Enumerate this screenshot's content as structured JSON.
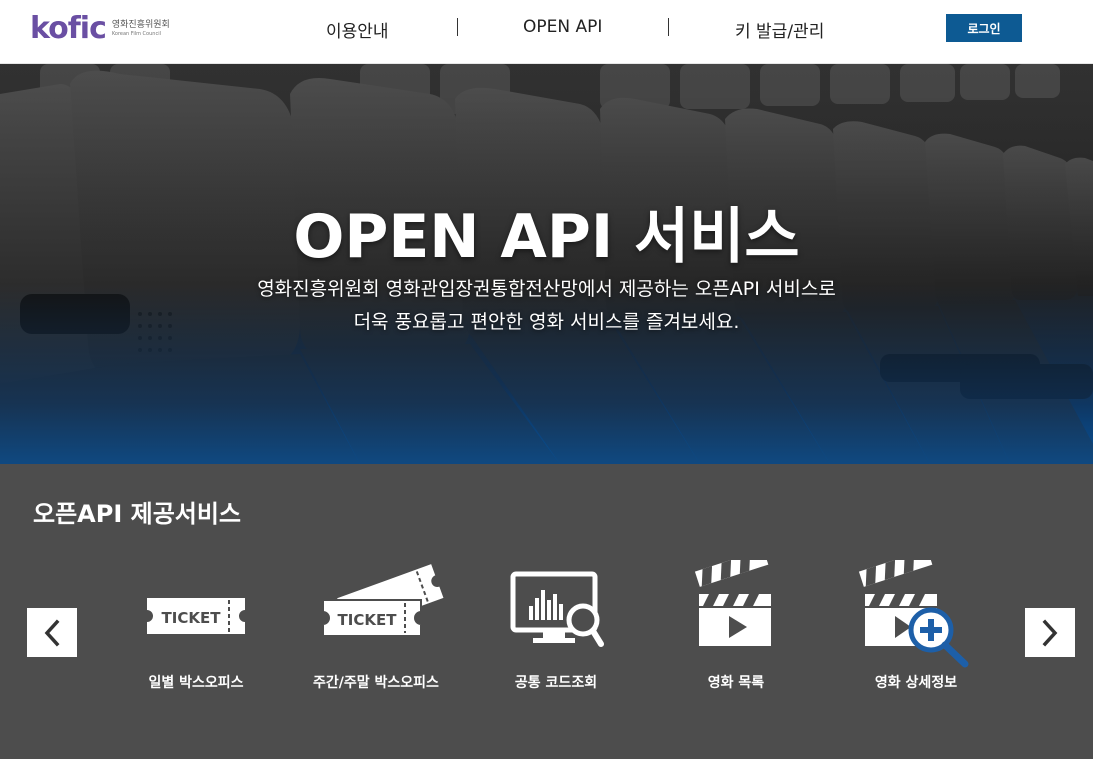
{
  "header": {
    "logo_text": "kofic",
    "logo_subtitle_ko": "영화진흥위원회",
    "logo_subtitle_en": "Korean Film Council",
    "nav": [
      "이용안내",
      "OPEN API",
      "키 발급/관리"
    ],
    "login_label": "로그인"
  },
  "hero": {
    "title": "OPEN API 서비스",
    "desc_line1": "영화진흥위원회 영화관입장권통합전산망에서 제공하는 오픈API 서비스로",
    "desc_line2": "더욱 풍요롭고 편안한 영화 서비스를 즐겨보세요."
  },
  "services": {
    "title": "오픈API 제공서비스",
    "items": [
      {
        "label": "일별 박스오피스",
        "icon": "ticket-icon",
        "ticket_text": "TICKET"
      },
      {
        "label": "주간/주말 박스오피스",
        "icon": "tickets-icon",
        "ticket_text": "TICKET"
      },
      {
        "label": "공통 코드조회",
        "icon": "monitor-search-icon"
      },
      {
        "label": "영화 목록",
        "icon": "clapperboard-play-icon"
      },
      {
        "label": "영화 상세정보",
        "icon": "clapperboard-zoom-icon"
      }
    ]
  },
  "colors": {
    "brand_purple": "#6a4fa3",
    "login_blue": "#0d5a93",
    "services_bg": "#4d4d4d",
    "magnifier_blue": "#1d5fa8"
  }
}
